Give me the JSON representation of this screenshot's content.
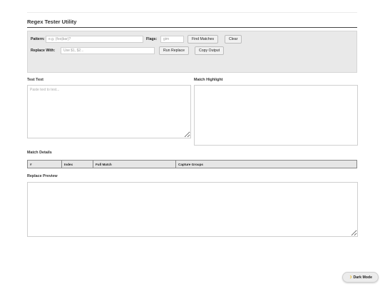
{
  "app": {
    "title": "Regex Tester Utility"
  },
  "toolbar": {
    "pattern_label": "Pattern:",
    "pattern_placeholder": "e.g. (foo|bar)?",
    "pattern_value": "",
    "flags_label": "Flags:",
    "flags_placeholder": "gim",
    "flags_value": "",
    "find_label": "Find Matches",
    "clear_label": "Clear",
    "replace_label": "Replace With:",
    "replace_placeholder": "Use $1, $2...",
    "replace_value": "",
    "run_replace_label": "Run Replace",
    "copy_output_label": "Copy Output"
  },
  "test_text": {
    "label": "Test Text",
    "placeholder": "Paste text to test..."
  },
  "match_highlight": {
    "label": "Match Highlight"
  },
  "match_details": {
    "label": "Match Details",
    "columns": [
      "#",
      "Index",
      "Full Match",
      "Capture Groups"
    ]
  },
  "replace_preview": {
    "label": "Replace Preview"
  },
  "theme_toggle": {
    "label": "Dark Mode",
    "icon": "moon-icon"
  },
  "colors": {
    "toolbar_bg": "#e9e9e9",
    "table_header_bg": "#e6e6e6",
    "icon_accent": "#e0a800"
  }
}
